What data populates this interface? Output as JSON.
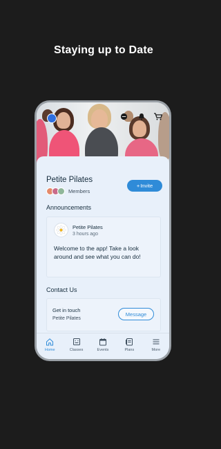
{
  "headline": "Staying up to Date",
  "group": {
    "name": "Petite Pilates",
    "members_label": "Members",
    "invite_label": "Invite"
  },
  "announcements": {
    "title": "Announcements",
    "post": {
      "author": "Petite Pilates",
      "time": "3 hours ago",
      "text": "Welcome to the app! Take a look around and see what you can do!"
    }
  },
  "contact": {
    "title": "Contact Us",
    "heading": "Get in touch",
    "name": "Petite Pilates",
    "message_label": "Message"
  },
  "tabs": [
    {
      "label": "Home",
      "icon": "home-icon",
      "active": true
    },
    {
      "label": "Classes",
      "icon": "classes-icon"
    },
    {
      "label": "Events",
      "icon": "calendar-icon"
    },
    {
      "label": "Plans",
      "icon": "plans-icon"
    },
    {
      "label": "More",
      "icon": "menu-icon"
    }
  ],
  "colors": {
    "accent": "#2f8bd8",
    "background": "#1c1c1c",
    "card": "#e8f0fa"
  }
}
